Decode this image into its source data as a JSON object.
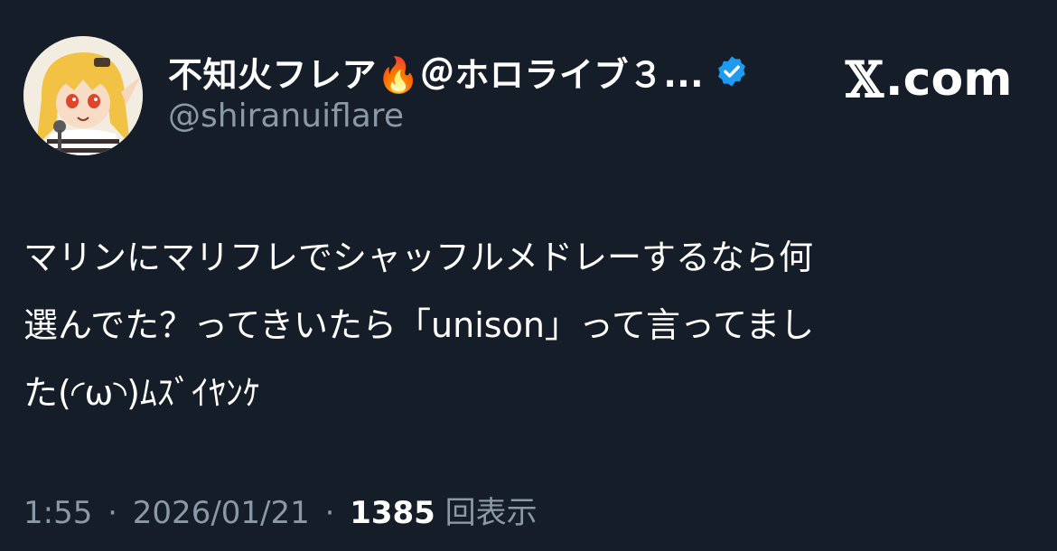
{
  "header": {
    "display_name": "不知火フレア🔥＠ホロライブ３...",
    "handle": "@shiranuiflare",
    "verified_icon": "verified-badge-icon",
    "brand_x": "𝕏",
    "brand_domain": ".com"
  },
  "tweet": {
    "lines": [
      "マリンにマリフレでシャッフルメドレーするなら何",
      "選んでた？ってきいたら「unison」って言ってまし",
      "た(◜ω◝)ﾑｽﾞｲﾔﾝｹ"
    ]
  },
  "meta": {
    "time": "1:55",
    "separator": "·",
    "date": "2026/01/21",
    "views_count": "1385",
    "views_label": "回表示"
  },
  "colors": {
    "background": "#151d28",
    "text_primary": "#ffffff",
    "text_secondary": "#8b98a5",
    "verified_blue": "#1d9bf0"
  }
}
